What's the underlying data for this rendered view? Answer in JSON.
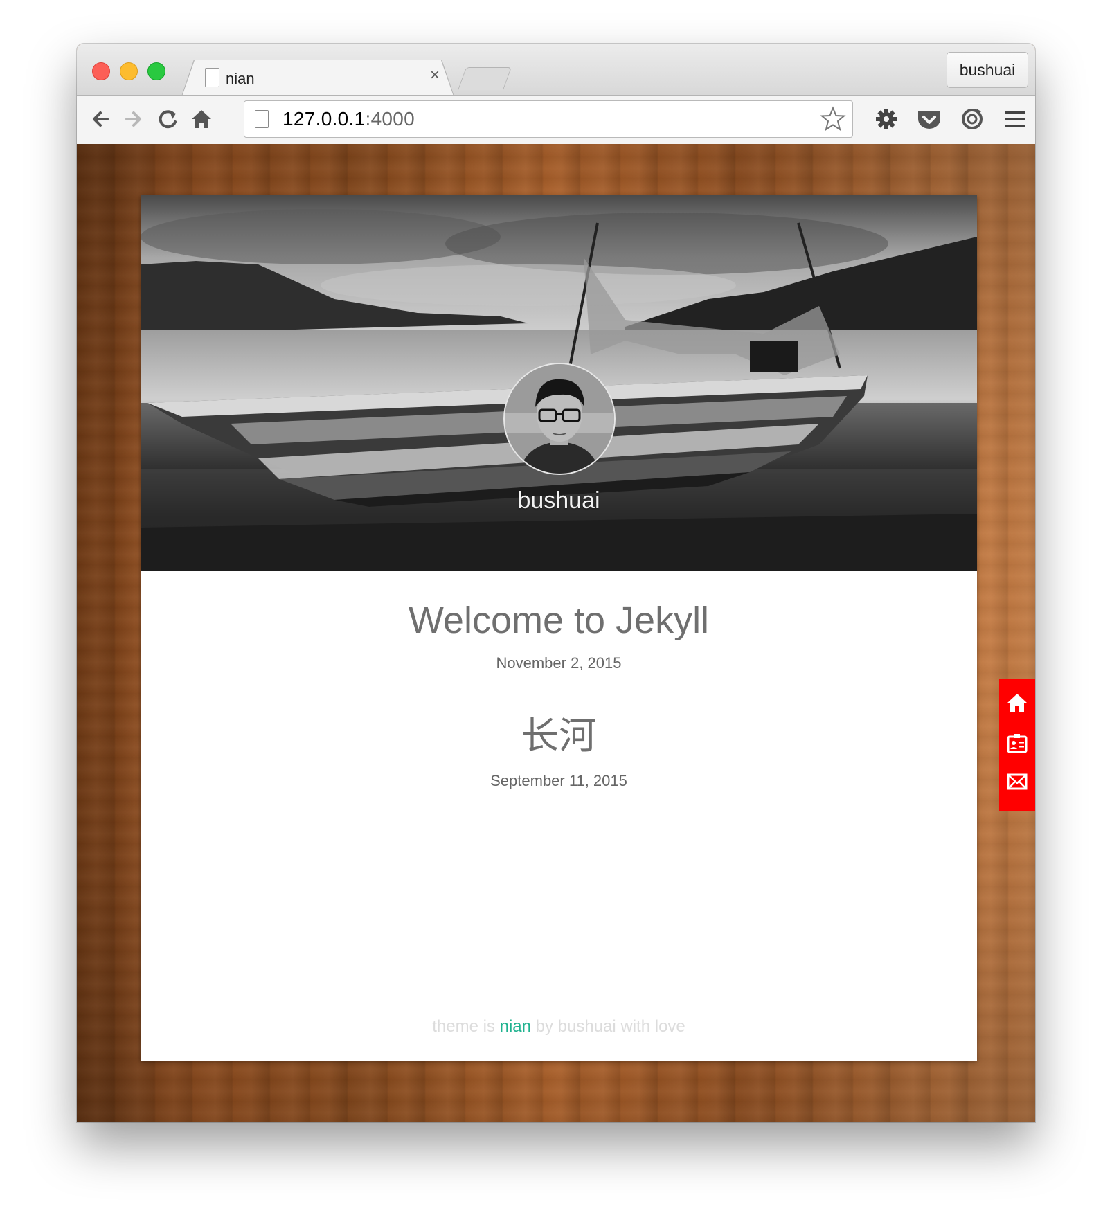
{
  "browser": {
    "tab_title": "nian",
    "tab_close": "×",
    "profile_name": "bushuai",
    "url_host": "127.0.0.1",
    "url_port": ":4000",
    "toolbar_icons": [
      "back-arrow-icon",
      "forward-arrow-icon",
      "reload-icon",
      "home-icon",
      "star-icon",
      "gear-icon",
      "pocket-icon",
      "sync-icon",
      "menu-icon"
    ]
  },
  "site": {
    "author": "bushuai",
    "posts": [
      {
        "title": "Welcome to Jekyll",
        "date": "November 2, 2015"
      },
      {
        "title": "长河",
        "date": "September 11, 2015"
      }
    ],
    "footer": {
      "prefix": "theme is ",
      "theme_name": "nian",
      "suffix": " by bushuai with love"
    },
    "side_menu_icons": [
      "home-icon",
      "contact-card-icon",
      "mail-icon"
    ],
    "colors": {
      "side_menu": "#ff0000",
      "theme_link": "#1fb28f"
    }
  }
}
